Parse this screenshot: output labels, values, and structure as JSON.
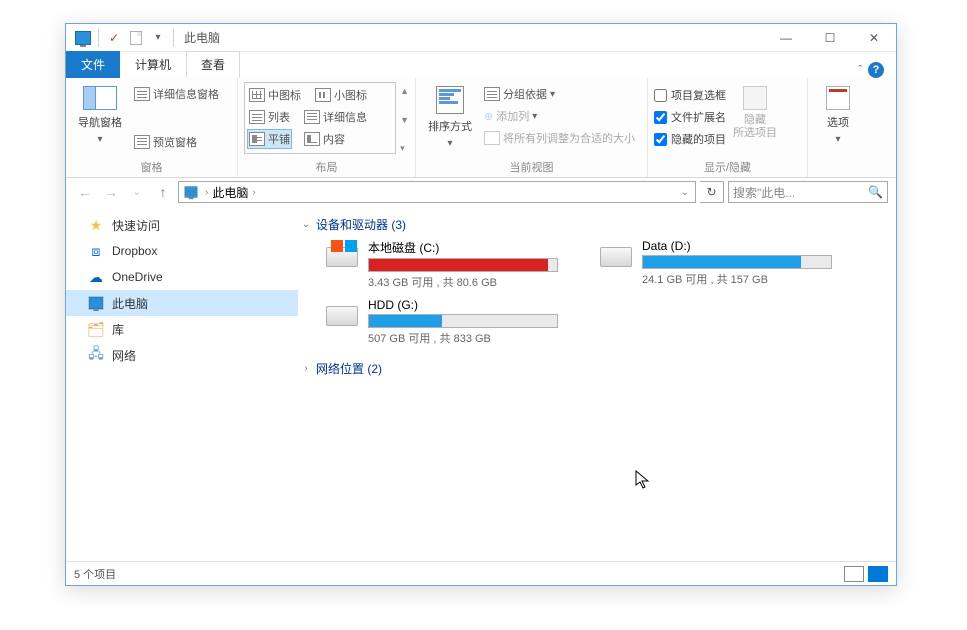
{
  "title": "此电脑",
  "tabs": {
    "file": "文件",
    "computer": "计算机",
    "view": "查看"
  },
  "ribbon": {
    "panes": {
      "nav_pane": "导航窗格",
      "preview_pane": "预览窗格",
      "details_info_pane": "详细信息窗格",
      "group_label": "窗格"
    },
    "layout": {
      "extra_large": "中图标",
      "small_icons": "小图标",
      "list": "列表",
      "details": "详细信息",
      "tiles": "平铺",
      "content": "内容",
      "group_label": "布局"
    },
    "currentview": {
      "sort": "排序方式",
      "group_by": "分组依据",
      "add_columns": "添加列",
      "auto_size": "将所有列调整为合适的大小",
      "group_label": "当前视图"
    },
    "showhide": {
      "item_checkboxes": "项目复选框",
      "file_ext": "文件扩展名",
      "hidden_items": "隐藏的项目",
      "hide_selected": "隐藏\n所选项目",
      "group_label": "显示/隐藏"
    },
    "options": {
      "label": "选项"
    }
  },
  "address": {
    "location": "此电脑",
    "search_placeholder": "搜索\"此电..."
  },
  "sidebar": {
    "items": [
      {
        "label": "快速访问",
        "icon": "star"
      },
      {
        "label": "Dropbox",
        "icon": "dropbox"
      },
      {
        "label": "OneDrive",
        "icon": "onedrive"
      },
      {
        "label": "此电脑",
        "icon": "pc",
        "selected": true
      },
      {
        "label": "库",
        "icon": "lib"
      },
      {
        "label": "网络",
        "icon": "net"
      }
    ]
  },
  "sections": {
    "devices": {
      "label": "设备和驱动器 (3)",
      "expanded": true
    },
    "network": {
      "label": "网络位置 (2)",
      "expanded": false
    }
  },
  "drives": [
    {
      "name": "本地磁盘 (C:)",
      "stat": "3.43 GB 可用 , 共 80.6 GB",
      "percent": 95,
      "color": "#d9221f",
      "icon": "win"
    },
    {
      "name": "Data (D:)",
      "stat": "24.1 GB 可用 , 共 157 GB",
      "percent": 84,
      "color": "#1e9fe8",
      "icon": "hdd"
    },
    {
      "name": "HDD (G:)",
      "stat": "507 GB 可用 , 共 833 GB",
      "percent": 39,
      "color": "#1e9fe8",
      "icon": "hdd"
    }
  ],
  "status": {
    "items": "5 个项目"
  }
}
